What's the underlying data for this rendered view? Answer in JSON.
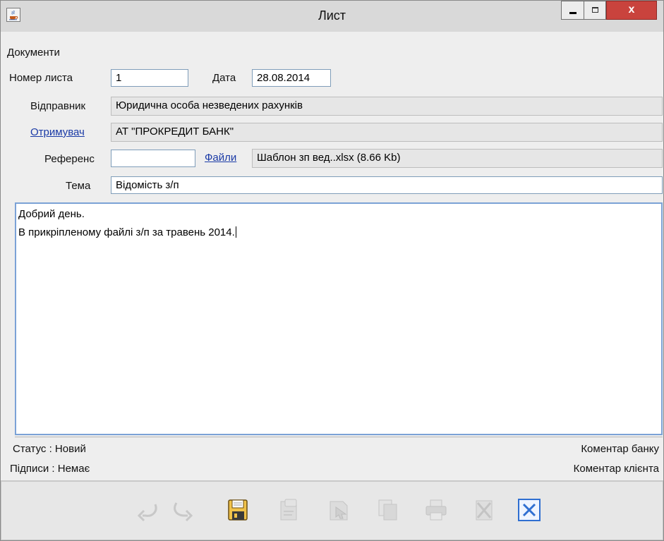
{
  "window": {
    "title": "Лист",
    "close_glyph": "x",
    "icon": "java-cup-icon"
  },
  "menu": {
    "documents": "Документи"
  },
  "form": {
    "number_label": "Номер листа",
    "number_value": "1",
    "date_label": "Дата",
    "date_value": "28.08.2014",
    "sender_label": "Відправник",
    "sender_value": "Юридична особа незведених рахунків",
    "recipient_label": "Отримувач",
    "recipient_value": "АТ \"ПРОКРЕДИТ БАНК\"",
    "reference_label": "Референс",
    "reference_value": "",
    "files_label": "Файли",
    "files_value": "Шаблон зп вед..xlsx (8.66 Kb)",
    "subject_label": "Тема",
    "subject_value": "Відомість з/п"
  },
  "message": {
    "line1": "Добрий день.",
    "line2": "",
    "line3": "В прикріпленому файлі з/п за травень 2014."
  },
  "status": {
    "status_text": "Статус :  Новий",
    "signatures_text": "Підписи :  Немає",
    "bank_comment": "Коментар банку",
    "client_comment": "Коментар клієнта"
  },
  "toolbar": {
    "buttons": [
      {
        "icon": "undo-icon",
        "enabled": false
      },
      {
        "icon": "redo-icon",
        "enabled": false
      },
      {
        "icon": "save-icon",
        "enabled": true
      },
      {
        "icon": "sign-icon",
        "enabled": false
      },
      {
        "icon": "send-icon",
        "enabled": false
      },
      {
        "icon": "copy-icon",
        "enabled": false
      },
      {
        "icon": "print-icon",
        "enabled": false
      },
      {
        "icon": "delete-icon",
        "enabled": false
      },
      {
        "icon": "close-icon",
        "enabled": true
      }
    ]
  },
  "colors": {
    "close_button": "#c9433d",
    "link": "#1a3aa6",
    "focus_border": "#7ba2d6",
    "close_icon_blue": "#2f6fd1"
  }
}
